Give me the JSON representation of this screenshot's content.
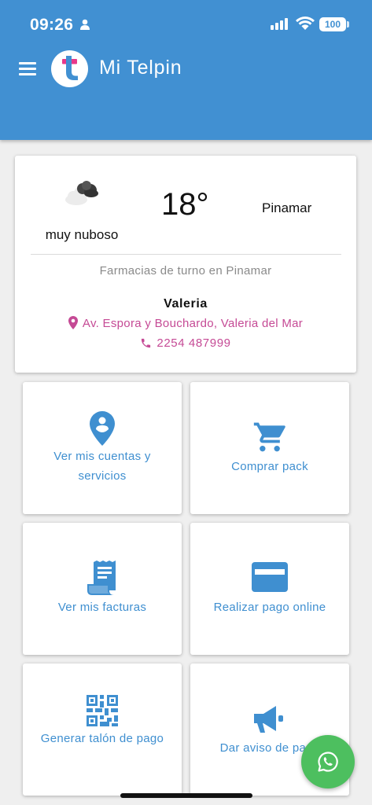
{
  "status_bar": {
    "time": "09:26",
    "battery": "100"
  },
  "header": {
    "app_title": "Mi Telpin",
    "logo_letter": "t"
  },
  "weather": {
    "condition": "muy nuboso",
    "temperature": "18°",
    "city": "Pinamar"
  },
  "pharmacy": {
    "heading": "Farmacias de turno en Pinamar",
    "name": "Valeria",
    "address": "Av. Espora y Bouchardo, Valeria del Mar",
    "phone": "2254 487999"
  },
  "tiles": [
    {
      "label": "Ver mis cuentas y servicios",
      "icon": "location-person-icon"
    },
    {
      "label": "Comprar pack",
      "icon": "cart-icon"
    },
    {
      "label": "Ver mis facturas",
      "icon": "receipt-icon"
    },
    {
      "label": "Realizar pago online",
      "icon": "credit-card-icon"
    },
    {
      "label": "Generar talón de pago",
      "icon": "qr-code-icon"
    },
    {
      "label": "Dar aviso de pago",
      "icon": "megaphone-icon"
    }
  ],
  "colors": {
    "header": "#4190d2",
    "accent_pink": "#c54a95",
    "tile_text": "#3f8fd0",
    "whatsapp_green": "#4dbf5f"
  }
}
